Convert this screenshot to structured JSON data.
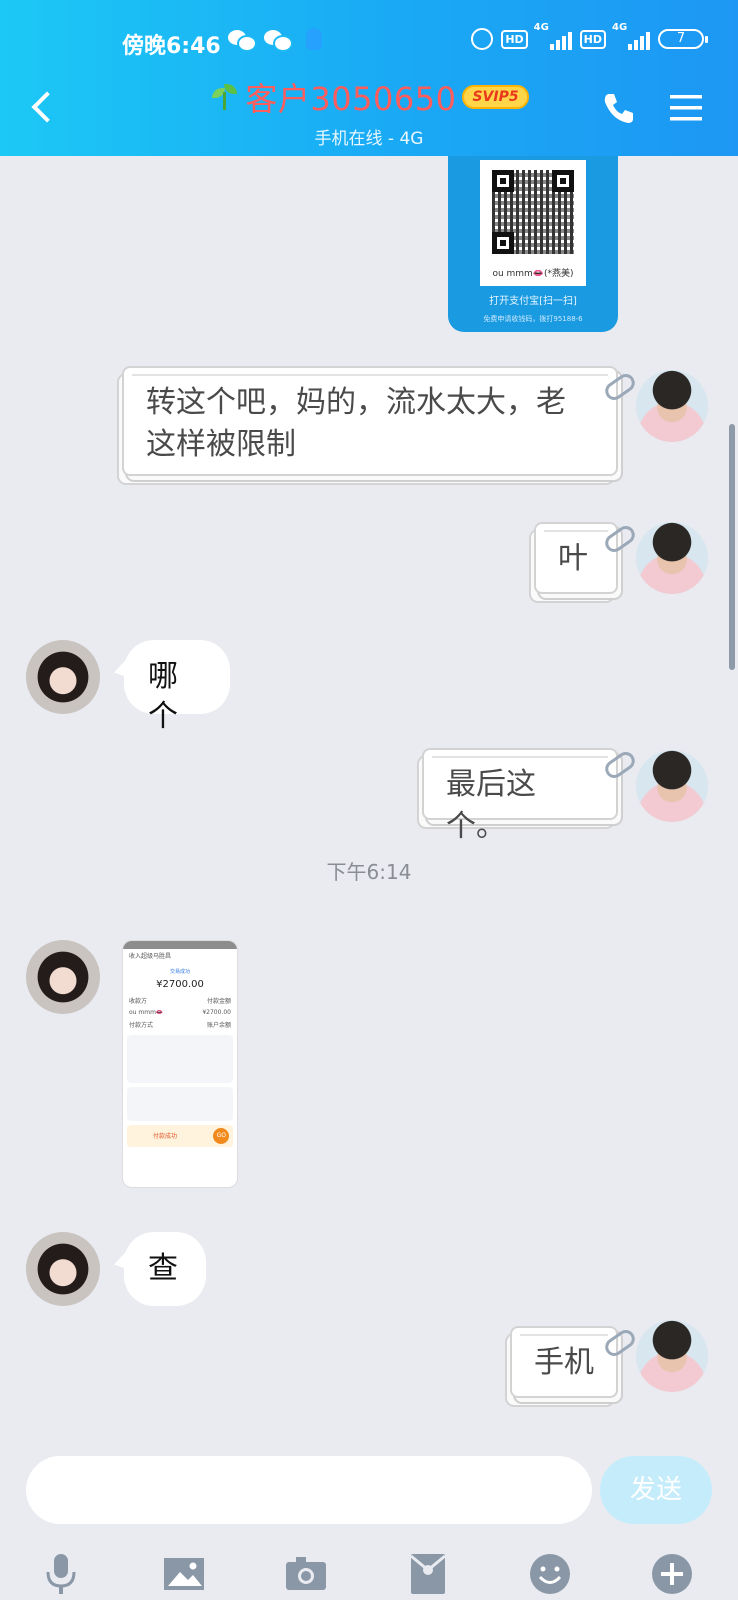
{
  "status_bar": {
    "time": "傍晚6:46",
    "hd1": "HD",
    "net1": "4G",
    "hd2": "HD",
    "net2": "4G",
    "battery": "7"
  },
  "header": {
    "title": "客户3050650",
    "vip_badge": "SVIP5",
    "subtitle": "手机在线 - 4G"
  },
  "qr_card": {
    "name": "ou mmm👄(*燕美)",
    "open_text": "打开支付宝[扫一扫]",
    "footer": "免费申请收钱码，拨打95188-6"
  },
  "messages": [
    {
      "from": "me",
      "text_line1": "转这个吧，妈的，流水太大，老",
      "text_line2": "这样被限制"
    },
    {
      "from": "me",
      "text": "叶"
    },
    {
      "from": "her",
      "text": "哪个"
    },
    {
      "from": "me",
      "text": "最后这个。"
    },
    {
      "from": "her",
      "text": "查"
    },
    {
      "from": "me",
      "text": "手机"
    }
  ],
  "timestamp": "下午6:14",
  "receipt": {
    "title": "收入超级马胜昌",
    "status": "交易成功",
    "amount": "¥2700.00",
    "payee_label": "收款方",
    "paid_label": "付款金额",
    "payee": "ou mmm👄",
    "paid": "¥2700.00",
    "method_label": "付款方式",
    "method": "账户余额",
    "promo_title": "付款成功",
    "go": "GO"
  },
  "input": {
    "placeholder": "",
    "send_label": "发送"
  },
  "toolbar": [
    "microphone-icon",
    "image-icon",
    "camera-icon",
    "red-packet-icon",
    "emoji-icon",
    "plus-icon"
  ]
}
